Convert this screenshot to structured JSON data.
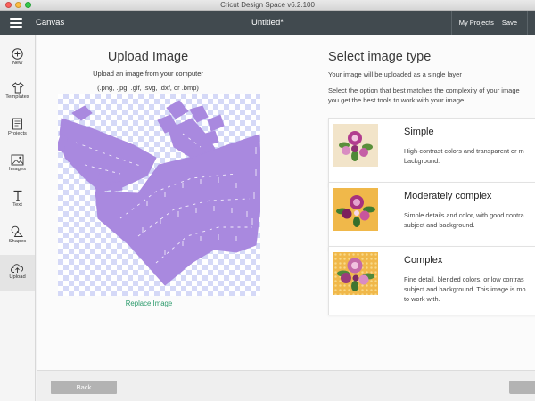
{
  "window": {
    "title": "Cricut Design Space  v6.2.100"
  },
  "header": {
    "section": "Canvas",
    "document_title": "Untitled*",
    "my_projects": "My Projects",
    "save": "Save"
  },
  "sidebar": {
    "items": [
      {
        "label": "New",
        "icon": "plus-circle-icon"
      },
      {
        "label": "Templates",
        "icon": "tshirt-icon"
      },
      {
        "label": "Projects",
        "icon": "projects-icon"
      },
      {
        "label": "Images",
        "icon": "image-icon"
      },
      {
        "label": "Text",
        "icon": "text-icon"
      },
      {
        "label": "Shapes",
        "icon": "shapes-icon"
      },
      {
        "label": "Upload",
        "icon": "cloud-upload-icon"
      }
    ],
    "active": "Upload"
  },
  "upload": {
    "title": "Upload Image",
    "subtitle": "Upload an image from your computer",
    "formats": "(.png, .jpg, .gif, .svg, .dxf, or .bmp)",
    "replace": "Replace Image"
  },
  "image_type": {
    "title": "Select image type",
    "desc1": "Your image will be uploaded as a single layer",
    "desc2_line1": "Select the option that best matches the complexity of your image",
    "desc2_line2": "you get the best tools to work with your image.",
    "options": [
      {
        "name": "Simple",
        "desc_line1": "High-contrast colors and transparent or m",
        "desc_line2": "background.",
        "desc_line3": ""
      },
      {
        "name": "Moderately complex",
        "desc_line1": "Simple details and color, with good contra",
        "desc_line2": "subject and background.",
        "desc_line3": ""
      },
      {
        "name": "Complex",
        "desc_line1": "Fine detail, blended colors, or low contras",
        "desc_line2": "subject and background. This image is mo",
        "desc_line3": "to work with."
      }
    ]
  },
  "footer": {
    "back": "Back"
  },
  "colors": {
    "header": "#414a4f",
    "shape": "#a989df",
    "link_green": "#2a9a6b",
    "checker": "#d5d9f7"
  }
}
